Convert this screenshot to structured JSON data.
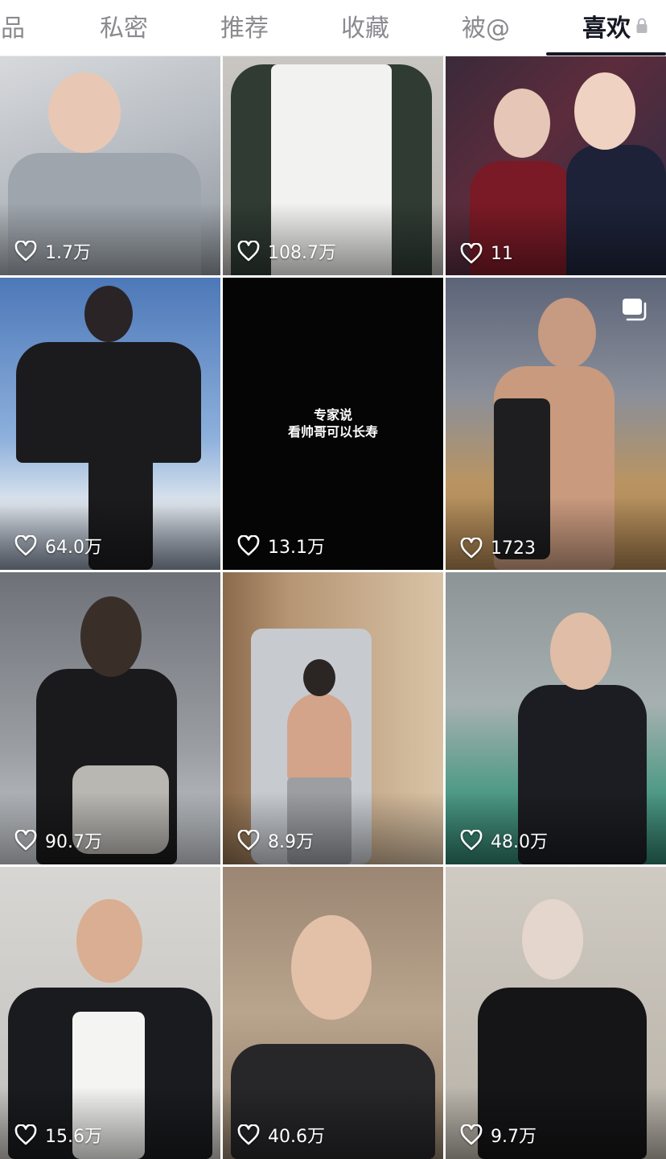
{
  "tabs": [
    {
      "label": "品",
      "active": false
    },
    {
      "label": "私密",
      "active": false
    },
    {
      "label": "推荐",
      "active": false
    },
    {
      "label": "收藏",
      "active": false
    },
    {
      "label": "被@",
      "active": false
    },
    {
      "label": "喜欢",
      "active": true,
      "icon": "lock-icon"
    }
  ],
  "videos": [
    {
      "likes": "1.7万"
    },
    {
      "likes": "108.7万"
    },
    {
      "likes": "11"
    },
    {
      "likes": "64.0万"
    },
    {
      "likes": "13.1万",
      "caption": [
        "专家说",
        "看帅哥可以长寿"
      ]
    },
    {
      "likes": "1723",
      "multi_icon": "image-stack-icon"
    },
    {
      "likes": "90.7万"
    },
    {
      "likes": "8.9万"
    },
    {
      "likes": "48.0万"
    },
    {
      "likes": "15.6万"
    },
    {
      "likes": "40.6万"
    },
    {
      "likes": "9.7万"
    }
  ],
  "colors": {
    "active_tab": "#161823",
    "inactive_tab": "#8a8a8f",
    "like_text": "#ffffff"
  }
}
